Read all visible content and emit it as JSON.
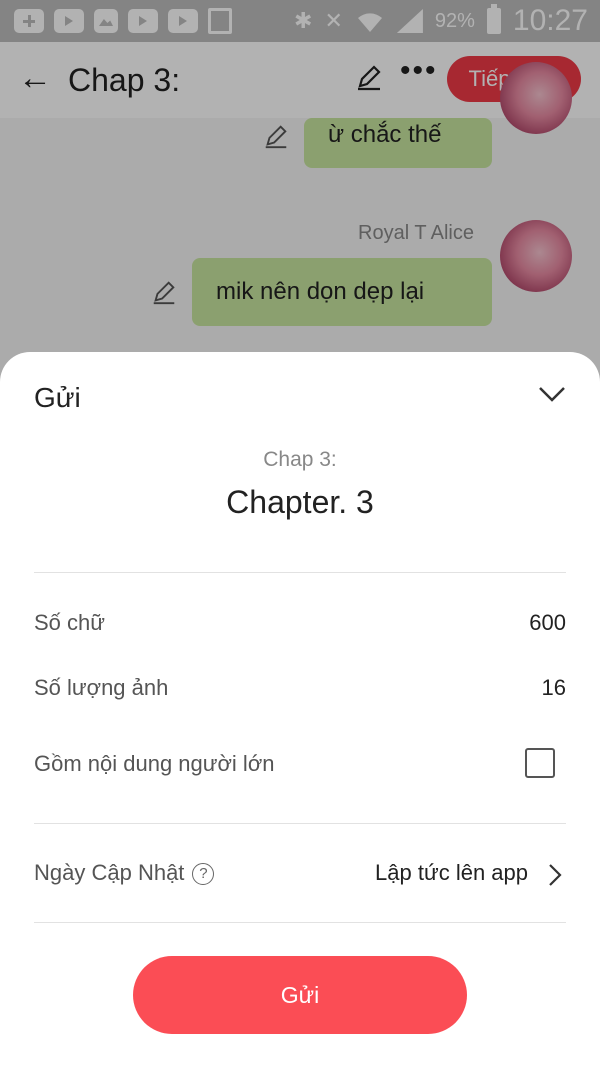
{
  "status_bar": {
    "battery_percent": "92%",
    "time": "10:27",
    "icons": [
      "plus-icon",
      "youtube-icon",
      "gallery-icon",
      "youtube-icon",
      "youtube-icon",
      "download-icon",
      "bluetooth-icon",
      "mute-icon",
      "wifi-icon",
      "signal-icon",
      "battery-icon"
    ]
  },
  "topbar": {
    "title": "Chap 3:",
    "next_label": "Tiếp theo",
    "accent": "#ef3a47"
  },
  "chat": {
    "messages": [
      {
        "text": "ừ chắc thế",
        "sender": ""
      },
      {
        "text": "mik nên dọn dẹp lại",
        "sender": "Royal T Alice"
      }
    ],
    "bubble_color": "#c8e6a0"
  },
  "sheet": {
    "title": "Gửi",
    "chapter_label": "Chap 3:",
    "chapter_name": "Chapter. 3",
    "rows": {
      "word_count_label": "Số chữ",
      "word_count_value": "600",
      "image_count_label": "Số lượng ảnh",
      "image_count_value": "16",
      "adult_label": "Gồm nội dung người lớn",
      "adult_checked": false,
      "update_label": "Ngày Cập Nhật",
      "help_glyph": "?",
      "update_value": "Lập tức lên app"
    },
    "send_label": "Gửi",
    "send_color": "#fb4d55"
  }
}
